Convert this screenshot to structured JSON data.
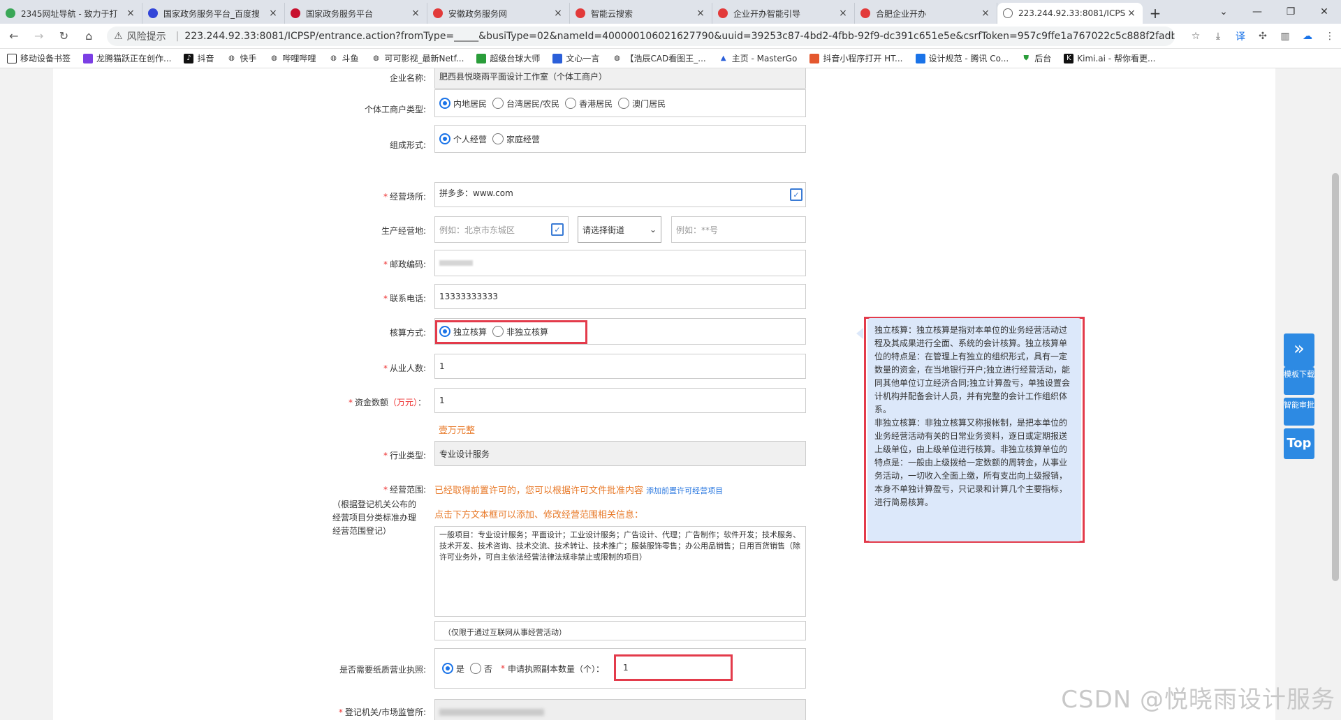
{
  "browser": {
    "tabs": [
      {
        "label": "2345网址导航 - 致力于打",
        "color": "#3aa757"
      },
      {
        "label": "国家政务服务平台_百度搜",
        "color": "#3245d8"
      },
      {
        "label": "国家政务服务平台",
        "color": "#c8102e"
      },
      {
        "label": "安徽政务服务网",
        "color": "#e23a3a"
      },
      {
        "label": "智能云搜索",
        "color": "#e23a3a"
      },
      {
        "label": "企业开办智能引导",
        "color": "#e23a3a"
      },
      {
        "label": "合肥企业开办",
        "color": "#e23a3a"
      },
      {
        "label": "223.244.92.33:8081/ICPS",
        "color": "#666666"
      }
    ],
    "address": {
      "risk": "风险提示",
      "url": "223.244.92.33:8081/ICPSP/entrance.action?fromType=_____&busiType=02&nameId=400000106021627790&uuid=39253c87-4bd2-4fbb-92f9-dc391c651e5e&csrfToken=957c9ffe1a767022c5c888f2fadb5ab1"
    },
    "bookmarks": [
      "移动设备书签",
      "龙腾猫跃正在创作...",
      "抖音",
      "快手",
      "哔哩哔哩",
      "斗鱼",
      "可可影视_最新Netf...",
      "超级台球大师",
      "文心一言",
      "【浩辰CAD看图王_...",
      "主页 - MasterGo",
      "抖音小程序打开 HT...",
      "设计规范 - 腾讯 Co...",
      "后台",
      "Kimi.ai - 帮你看更..."
    ]
  },
  "form": {
    "company_name_label": "企业名称:",
    "company_name": "肥西县悦晓雨平面设计工作室（个体工商户）",
    "household_type_label": "个体工商户类型:",
    "household_types": [
      "内地居民",
      "台湾居民/农民",
      "香港居民",
      "澳门居民"
    ],
    "form_type_label": "组成形式:",
    "form_types": [
      "个人经营",
      "家庭经营"
    ],
    "place_label": "经营场所:",
    "place_value": "拼多多：www.com",
    "prod_label": "生产经营地:",
    "prod_placeholder1": "例如：北京市东城区",
    "prod_select": "请选择街道",
    "prod_placeholder2": "例如：**号",
    "postcode_label": "邮政编码:",
    "phone_label": "联系电话:",
    "phone_value": "13333333333",
    "accounting_label": "核算方式:",
    "accounting_types": [
      "独立核算",
      "非独立核算"
    ],
    "staff_label": "从业人数:",
    "staff_value": "1",
    "capital_label": "资金数额",
    "capital_unit": "（万元）",
    "capital_colon": "：",
    "capital_value": "1",
    "capital_words": "壹万元整",
    "industry_label": "行业类型:",
    "industry_value": "专业设计服务",
    "scope_label": "经营范围:",
    "scope_note": "（根据登记机关公布的经营项目分类标准办理经营范围登记）",
    "scope_hint1": "已经取得前置许可的，您可以根据许可文件批准内容",
    "scope_hint_link": "添加前置许可经营项目",
    "scope_hint2": "点击下方文本框可以添加、修改经营范围相关信息：",
    "scope_text": "一般项目：专业设计服务；平面设计；工业设计服务；广告设计、代理；广告制作；软件开发；技术服务、技术开发、技术咨询、技术交流、技术转让、技术推广；服装服饰零售；办公用品销售；日用百货销售（除许可业务外，可自主依法经营法律法规非禁止或限制的项目）",
    "internet_note": "（仅限于通过互联网从事经营活动）",
    "paper_label": "是否需要纸质营业执照:",
    "paper_options": [
      "是",
      "否"
    ],
    "copies_label": "申请执照副本数量（个）：",
    "copies_value": "1",
    "registry_label": "登记机关/市场监管所:"
  },
  "tooltip": {
    "text1": "独立核算：独立核算是指对本单位的业务经营活动过程及其成果进行全面、系统的会计核算。独立核算单位的特点是：在管理上有独立的组织形式，具有一定数量的资金，在当地银行开户;独立进行经营活动，能同其他单位订立经济合同;独立计算盈亏，单独设置会计机构并配备会计人员，并有完整的会计工作组织体系。",
    "text2": "非独立核算：非独立核算又称报帐制，是把本单位的业务经营活动有关的日常业务资料，逐日或定期报送上级单位，由上级单位进行核算。非独立核算单位的特点是：一般由上级拨给一定数额的周转金，从事业务活动，一切收入全面上缴，所有支出向上级报销，本身不单独计算盈亏，只记录和计算几个主要指标，进行简易核算。"
  },
  "floating": {
    "template": "模板下载",
    "approval": "智能审批",
    "top": "Top"
  },
  "watermark": "CSDN @悦晓雨设计服务"
}
